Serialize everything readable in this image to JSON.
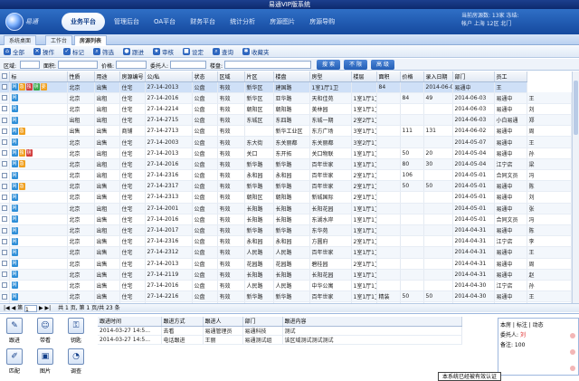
{
  "window": {
    "title": "易通VIP版系统"
  },
  "nav": {
    "tabs": [
      "业务平台",
      "管理后台",
      "OA平台",
      "财务平台",
      "统计分析",
      "房源图片",
      "房源导购"
    ],
    "active": 0
  },
  "user": {
    "line1": "当前房源数: 13家 冻结:",
    "line2": "帐户 上海 12区 北门"
  },
  "page_tabs": [
    "系统桌面",
    "工作台",
    "房源列表"
  ],
  "toolbar": {
    "items": [
      {
        "icon": "home-icon",
        "label": "全部"
      },
      {
        "icon": "tools-icon",
        "label": "操作"
      },
      {
        "icon": "check-icon",
        "label": "标记"
      },
      {
        "icon": "search-icon",
        "label": "筛选"
      },
      {
        "icon": "person-icon",
        "label": "跟进"
      },
      {
        "icon": "star-icon",
        "label": "审核"
      },
      {
        "icon": "lock-icon",
        "label": "设定"
      },
      {
        "icon": "magnifier-icon",
        "label": "查询"
      },
      {
        "icon": "gear-icon",
        "label": "收藏夹"
      }
    ]
  },
  "search": {
    "labels": [
      "区域:",
      "面积:",
      "价格:",
      "委托人:",
      "楼盘:"
    ],
    "buttons": [
      "搜 索",
      "不 限",
      "高 级"
    ]
  },
  "grid": {
    "columns": [
      "",
      "标",
      "性质",
      "用途",
      "房源编号",
      "公/私",
      "状态",
      "区域",
      "片区",
      "楼盘",
      "房型",
      "楼层",
      "面积",
      "价格",
      "录入日期",
      "部门",
      "员工"
    ],
    "rows": [
      [
        "",
        "北京",
        "出售",
        "住宅",
        "27-14-2013",
        "公盘",
        "有效",
        "新华区",
        "建国路",
        "1室1厅1卫",
        "",
        "84",
        "",
        "2014-06-06",
        "易通中",
        "王"
      ],
      [
        "",
        "北京",
        "出租",
        "住宅",
        "27-14-2016",
        "公盘",
        "有效",
        "新华区",
        "亚华路",
        "天和佳苑",
        "1室1厅1卫",
        "",
        "84",
        "49",
        "2014-06-03",
        "易通中",
        "王"
      ],
      [
        "",
        "北京",
        "出租",
        "住宅",
        "27-14-2214",
        "公盘",
        "有效",
        "朝阳区",
        "朝阳路",
        "美林园",
        "1室1厅1卫",
        "",
        "",
        "",
        "2014-06-03",
        "易通中",
        "刘"
      ],
      [
        "",
        "出租",
        "出租",
        "住宅",
        "27-14-2715",
        "公盘",
        "有效",
        "东城区",
        "东四路",
        "东城一期",
        "2室2厅1卫",
        "",
        "",
        "",
        "2014-06-03",
        "小白易通",
        "郑"
      ],
      [
        "",
        "出售",
        "出售",
        "商铺",
        "27-14-2713",
        "公盘",
        "有效",
        "",
        "新华工业区",
        "东方广场",
        "3室1厅1卫",
        "",
        "111",
        "131",
        "2014-06-02",
        "易通中",
        "周"
      ],
      [
        "",
        "北京",
        "出售",
        "住宅",
        "27-14-2003",
        "公盘",
        "有效",
        "东大街",
        "东关丽都",
        "东关丽都",
        "3室2厅1卫",
        "",
        "",
        "",
        "2014-05-07",
        "易通中",
        "王"
      ],
      [
        "",
        "北京",
        "出租",
        "住宅",
        "27-14-2013",
        "公盘",
        "有效",
        "关口",
        "东开拓",
        "关口物联",
        "1室1厅1卫",
        "",
        "50",
        "20",
        "2014-05-04",
        "易通中",
        "孙"
      ],
      [
        "",
        "北京",
        "出租",
        "住宅",
        "27-14-2016",
        "公盘",
        "有效",
        "新华路",
        "新华路",
        "百年世家",
        "1室1厅1卫",
        "",
        "80",
        "30",
        "2014-05-04",
        "江宁店",
        "梁"
      ],
      [
        "",
        "北京",
        "出租",
        "住宅",
        "27-14-2316",
        "公盘",
        "有效",
        "永和园",
        "永和园",
        "百年世家",
        "2室1厅1卫",
        "",
        "106",
        "",
        "2014-05-01",
        "合同文员",
        "冯"
      ],
      [
        "",
        "北京",
        "出售",
        "住宅",
        "27-14-2317",
        "公盘",
        "有效",
        "新华路",
        "新华路",
        "百年世家",
        "2室1厅1卫",
        "",
        "50",
        "50",
        "2014-05-01",
        "易通中",
        "陈"
      ],
      [
        "",
        "北京",
        "出售",
        "住宅",
        "27-14-2313",
        "公盘",
        "有效",
        "朝阳区",
        "朝阳路",
        "新城国际",
        "2室1厅1卫",
        "",
        "",
        "",
        "2014-05-01",
        "易通中",
        "刘"
      ],
      [
        "",
        "北京",
        "出租",
        "住宅",
        "27-14-2001",
        "公盘",
        "有效",
        "长阳路",
        "长阳路",
        "长阳花园",
        "1室1厅1卫",
        "",
        "",
        "",
        "2014-05-01",
        "易通中",
        "张"
      ],
      [
        "",
        "北京",
        "出售",
        "住宅",
        "27-14-2016",
        "公盘",
        "有效",
        "长阳路",
        "长阳路",
        "东湖水岸",
        "1室1厅1卫",
        "",
        "",
        "",
        "2014-05-01",
        "合同文员",
        "冯"
      ],
      [
        "",
        "北京",
        "出租",
        "住宅",
        "27-14-2017",
        "公盘",
        "有效",
        "新华路",
        "新华路",
        "东华苑",
        "1室1厅1卫",
        "",
        "",
        "",
        "2014-04-31",
        "易通中",
        "陈"
      ],
      [
        "",
        "北京",
        "出售",
        "住宅",
        "27-14-2316",
        "公盘",
        "有效",
        "永和园",
        "永和园",
        "方圆府",
        "2室1厅1卫",
        "",
        "",
        "",
        "2014-04-31",
        "江宁店",
        "李"
      ],
      [
        "",
        "北京",
        "出售",
        "住宅",
        "27-14-2312",
        "公盘",
        "有效",
        "人民路",
        "人民路",
        "百年世家",
        "1室1厅1卫",
        "",
        "",
        "",
        "2014-04-31",
        "易通中",
        "王"
      ],
      [
        "",
        "北京",
        "出售",
        "住宅",
        "27-14-2013",
        "公盘",
        "有效",
        "花园路",
        "花园路",
        "碧桂园",
        "2室1厅1卫",
        "",
        "",
        "",
        "2014-04-31",
        "易通中",
        "周"
      ],
      [
        "",
        "北京",
        "出售",
        "住宅",
        "27-14-2119",
        "公盘",
        "有效",
        "长阳路",
        "长阳路",
        "长阳花园",
        "1室1厅1卫",
        "",
        "",
        "",
        "2014-04-31",
        "易通中",
        "赵"
      ],
      [
        "",
        "北京",
        "出售",
        "住宅",
        "27-14-2016",
        "公盘",
        "有效",
        "人民路",
        "人民路",
        "中华公寓",
        "1室1厅1卫",
        "",
        "",
        "",
        "2014-04-30",
        "江宁店",
        "孙"
      ],
      [
        "",
        "北京",
        "出售",
        "住宅",
        "27-14-2216",
        "公盘",
        "有效",
        "新华路",
        "新华路",
        "百年世家",
        "1室1厅1卫",
        "精装",
        "50",
        "50",
        "2014-04-30",
        "易通中",
        "王"
      ],
      [
        "",
        "北京",
        "出租",
        "住宅",
        "27-14-2312",
        "公盘",
        "有效",
        "新城区",
        "新城区",
        "东方花园",
        "2室1厅1卫",
        "",
        "",
        "",
        "2014-04-30",
        "小白易通",
        "郑"
      ],
      [
        "",
        "北京",
        "出售",
        "住宅",
        "27-14-2013",
        "公盘",
        "有效",
        "新华路",
        "新华路",
        "百年世家",
        "1室1厅1卫",
        "",
        "",
        "",
        "2014-04-30",
        "江宁店",
        "钱"
      ],
      [
        "",
        "北京",
        "出售",
        "住宅",
        "27-14-2004",
        "公盘",
        "有效",
        "东华路",
        "东华路",
        "现代花园",
        "1室1厅1卫",
        "",
        "",
        "",
        "2014-04-30",
        "易通中",
        "吴"
      ]
    ],
    "row_tags": [
      [
        "网",
        "急",
        "独",
        "钥",
        "委"
      ],
      [
        "网"
      ],
      [
        "网"
      ],
      [
        "网"
      ],
      [
        "网",
        "急"
      ],
      [
        "网"
      ],
      [
        "网",
        "独",
        "钥"
      ],
      [
        "网",
        "急"
      ],
      [
        "网"
      ],
      [
        "网",
        "急"
      ],
      [
        "网"
      ],
      [
        "网"
      ],
      [
        "网"
      ],
      [
        "网"
      ],
      [
        "网"
      ],
      [
        "网"
      ],
      [
        "网"
      ],
      [
        "网"
      ],
      [
        "网"
      ],
      [
        "网"
      ],
      [
        "网"
      ],
      [
        "网"
      ],
      [
        "网"
      ]
    ]
  },
  "pager": {
    "text": "共 1 页, 第 1 页/共 23 条",
    "first": "|◀",
    "prev": "◀",
    "next": "▶",
    "last": "▶|",
    "page_label": "第",
    "page_value": "1"
  },
  "quick": [
    {
      "icon": "check-doc-icon",
      "label": "跟进"
    },
    {
      "icon": "people-icon",
      "label": "带看"
    },
    {
      "icon": "chart-icon",
      "label": "钥匙"
    },
    {
      "icon": "pencil-icon",
      "label": "匹配"
    },
    {
      "icon": "image-icon",
      "label": "图片"
    },
    {
      "icon": "pie-icon",
      "label": "调查"
    }
  ],
  "log": {
    "columns": [
      "跟进时间",
      "跟进方式",
      "跟进人",
      "部门",
      "跟进内容"
    ],
    "rows": [
      [
        "2014-03-27 14:5...",
        "去看",
        "易通管理员",
        "易通科技",
        "测试"
      ],
      [
        "2014-03-27 14:5...",
        "电话跟进",
        "王丽",
        "易通测试组",
        "该区域测试测试测试"
      ]
    ]
  },
  "notice": {
    "line1": "本房 | 标注 | 动态",
    "line2_label": "委托人:",
    "line2_value": "刘",
    "line3": "备注: 100"
  },
  "statusbar": {
    "text": "本系统已经被有效认证"
  }
}
